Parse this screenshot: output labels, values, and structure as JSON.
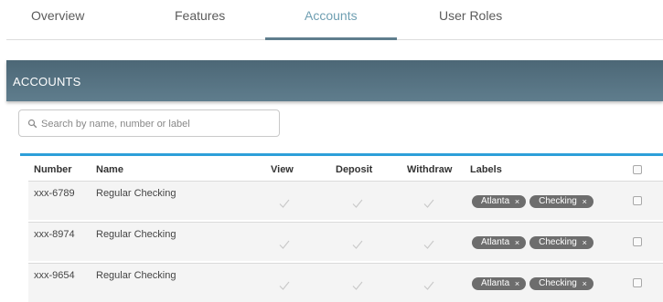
{
  "tabs": [
    {
      "label": "Overview",
      "active": false
    },
    {
      "label": "Features",
      "active": false
    },
    {
      "label": "Accounts",
      "active": true
    },
    {
      "label": "User Roles",
      "active": false
    }
  ],
  "section": {
    "title": "ACCOUNTS"
  },
  "search": {
    "placeholder": "Search by name, number or label",
    "value": ""
  },
  "table": {
    "headers": {
      "number": "Number",
      "name": "Name",
      "view": "View",
      "deposit": "Deposit",
      "withdraw": "Withdraw",
      "labels": "Labels"
    },
    "rows": [
      {
        "number": "xxx-6789",
        "name": "Regular Checking",
        "view": true,
        "deposit": true,
        "withdraw": true,
        "labels": [
          "Atlanta",
          "Checking"
        ]
      },
      {
        "number": "xxx-8974",
        "name": "Regular Checking",
        "view": true,
        "deposit": true,
        "withdraw": true,
        "labels": [
          "Atlanta",
          "Checking"
        ]
      },
      {
        "number": "xxx-9654",
        "name": "Regular Checking",
        "view": true,
        "deposit": true,
        "withdraw": true,
        "labels": [
          "Atlanta",
          "Checking"
        ]
      }
    ]
  },
  "icons": {
    "search": "search-icon",
    "check": "checkmark-icon",
    "remove": "close-icon"
  },
  "colors": {
    "header_bar": "#4c6776",
    "table_accent": "#2d9fd9",
    "tab_active_text": "#6f9fb2",
    "tab_indicator": "#5f7e8d",
    "tag_bg": "#6d6d6d",
    "checkmark": "#c8c8c8"
  },
  "tag_remove_glyph": "×"
}
